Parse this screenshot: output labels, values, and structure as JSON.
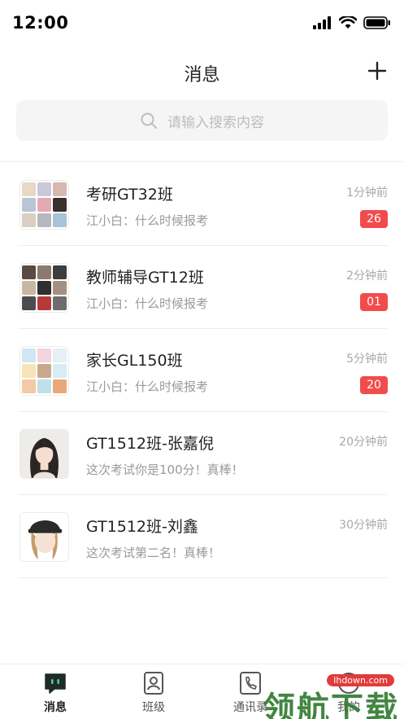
{
  "status": {
    "time": "12:00",
    "icons": [
      "signal-icon",
      "wifi-icon",
      "battery-icon"
    ]
  },
  "header": {
    "title": "消息",
    "add_icon": "plus-icon"
  },
  "search": {
    "placeholder": "请输入搜索内容",
    "icon": "search-icon"
  },
  "conversations": [
    {
      "title": "考研GT32班",
      "preview": "江小白：什么时候报考",
      "time": "1分钟前",
      "unread": "26",
      "avatar": "group-avatar"
    },
    {
      "title": "教师辅导GT12班",
      "preview": "江小白：什么时候报考",
      "time": "2分钟前",
      "unread": "01",
      "avatar": "group-avatar"
    },
    {
      "title": "家长GL150班",
      "preview": "江小白：什么时候报考",
      "time": "5分钟前",
      "unread": "20",
      "avatar": "group-avatar"
    },
    {
      "title": "GT1512班-张嘉倪",
      "preview": "这次考试你是100分！真棒！",
      "time": "20分钟前",
      "avatar": "user-avatar"
    },
    {
      "title": "GT1512班-刘鑫",
      "preview": "这次考试第二名！真棒！",
      "time": "30分钟前",
      "avatar": "user-avatar"
    }
  ],
  "tabs": [
    {
      "label": "消息",
      "icon": "message-icon",
      "active": true
    },
    {
      "label": "班级",
      "icon": "class-icon",
      "active": false
    },
    {
      "label": "通讯录",
      "icon": "contacts-icon",
      "active": false
    },
    {
      "label": "我的",
      "icon": "profile-icon",
      "active": false
    }
  ],
  "watermark": {
    "url": "lhdown.com",
    "text": "领航下载"
  },
  "colors": {
    "badge": "#f24b4b",
    "search_bg": "#f5f5f5",
    "text_primary": "#222222",
    "text_secondary": "#9a9a9a"
  }
}
